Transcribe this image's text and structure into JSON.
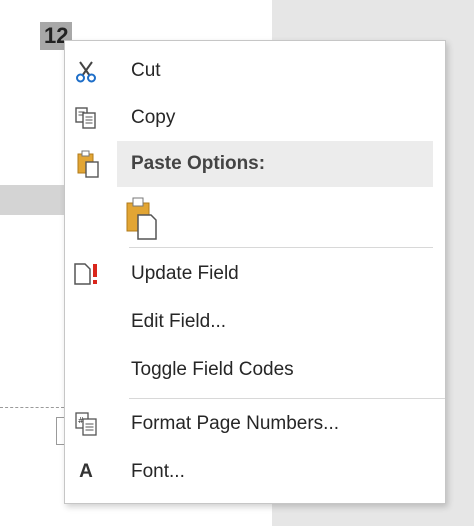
{
  "document": {
    "page_number_label": "12"
  },
  "context_menu": {
    "cut": {
      "label": "Cut",
      "icon": "scissors-icon"
    },
    "copy": {
      "label": "Copy",
      "icon": "copy-icon"
    },
    "paste_options": {
      "label": "Paste Options:",
      "icon": "clipboard-icon",
      "option_icon": "paste-keep-source-icon"
    },
    "update_field": {
      "label": "Update Field",
      "icon": "update-field-icon"
    },
    "edit_field": {
      "label": "Edit Field..."
    },
    "toggle_field_codes": {
      "label": "Toggle Field Codes"
    },
    "format_page_numbers": {
      "label": "Format Page Numbers...",
      "icon": "page-number-format-icon"
    },
    "font": {
      "label": "Font...",
      "icon_letter": "A"
    }
  },
  "colors": {
    "accent_red": "#d9261c",
    "clipboard_orange": "#e2a534",
    "menu_hover": "#ececec"
  }
}
